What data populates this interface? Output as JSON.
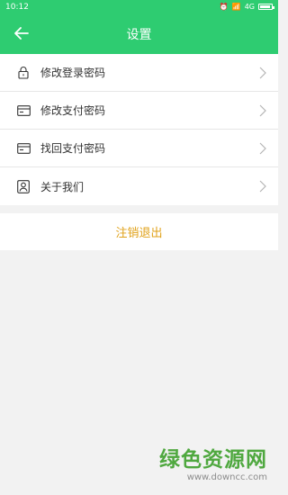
{
  "status_bar": {
    "time": "10:12",
    "network": "4G"
  },
  "app_bar": {
    "title": "设置",
    "back_icon": "arrow-left-icon"
  },
  "menu": [
    {
      "icon": "lock-icon",
      "label": "修改登录密码"
    },
    {
      "icon": "card-icon",
      "label": "修改支付密码"
    },
    {
      "icon": "card-icon",
      "label": "找回支付密码"
    },
    {
      "icon": "profile-icon",
      "label": "关于我们"
    }
  ],
  "logout_label": "注销退出",
  "watermark": {
    "name": "绿色资源网",
    "url": "www.downcc.com"
  },
  "colors": {
    "accent": "#2ecc71",
    "logout_text": "#e0a21a",
    "background": "#f2f2f2"
  }
}
